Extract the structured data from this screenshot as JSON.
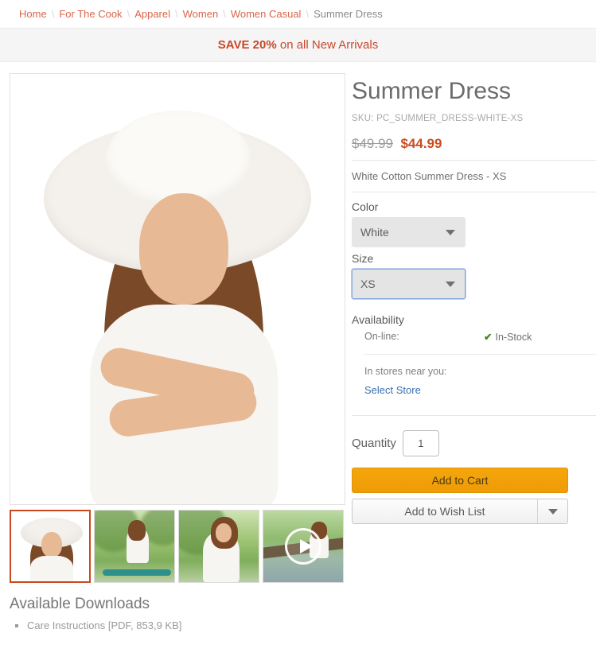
{
  "breadcrumb": {
    "separator": "\\",
    "items": [
      {
        "label": "Home",
        "current": false
      },
      {
        "label": "For The Cook",
        "current": false
      },
      {
        "label": "Apparel",
        "current": false
      },
      {
        "label": "Women",
        "current": false
      },
      {
        "label": "Women Casual",
        "current": false
      },
      {
        "label": "Summer Dress",
        "current": true
      }
    ]
  },
  "promo": {
    "bold_text": "SAVE 20%",
    "rest_text": " on all New Arrivals",
    "color": "#c9472a",
    "background": "#f5f5f5"
  },
  "gallery": {
    "main_image_alt": "Woman in white summer dress and wide-brim white sun hat on white background",
    "thumbnails": [
      {
        "alt": "Woman in white dress and white sun hat, studio",
        "selected": true,
        "is_video": false
      },
      {
        "alt": "Woman in white dress with teal bicycle on sunny path",
        "selected": false,
        "is_video": false
      },
      {
        "alt": "Smiling woman in white off-shoulder dress outdoors",
        "selected": false,
        "is_video": false
      },
      {
        "alt": "Woman in white dress sitting on fallen log over stream",
        "selected": false,
        "is_video": true
      }
    ],
    "selected_border_color": "#c8491d",
    "play_icon": "play-icon"
  },
  "product": {
    "title": "Summer Dress",
    "sku_label": "SKU:",
    "sku_value": "PC_SUMMER_DRESS-WHITE-XS",
    "price_old": "$49.99",
    "price_new": "$44.99",
    "price_new_color": "#cc4b20",
    "short_description": "White Cotton Summer Dress - XS"
  },
  "options": {
    "color": {
      "label": "Color",
      "value": "White",
      "focused": false,
      "caret_icon": "chevron-down-icon"
    },
    "size": {
      "label": "Size",
      "value": "XS",
      "focused": true,
      "caret_icon": "chevron-down-icon"
    }
  },
  "availability": {
    "title": "Availability",
    "online_label": "On-line:",
    "online_status": "In-Stock",
    "status_icon": "check-icon",
    "status_color": "#3f8a22",
    "stores_label": "In stores near you:",
    "select_store_link": "Select Store"
  },
  "purchase": {
    "quantity_label": "Quantity",
    "quantity_value": "1",
    "add_to_cart_label": "Add to Cart",
    "add_to_cart_color": "#f5a60c",
    "wish_list_label": "Add to Wish List",
    "wish_caret_icon": "chevron-down-icon"
  },
  "downloads": {
    "heading": "Available Downloads",
    "items": [
      {
        "label": "Care Instructions [PDF, 853,9 KB]"
      }
    ]
  }
}
